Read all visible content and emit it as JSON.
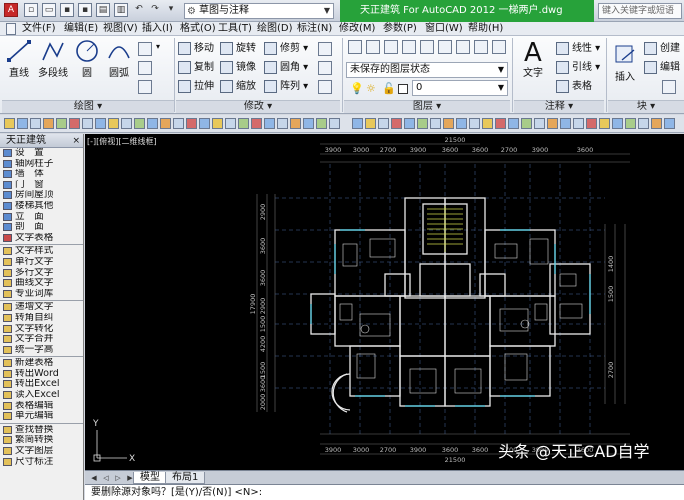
{
  "title_bar": {
    "workspace": "草图与注释",
    "app_title": "天正建筑 For AutoCAD 2012    一梯两户.dwg",
    "search_placeholder": "键入关键字或短语"
  },
  "menu": [
    "文件(F)",
    "编辑(E)",
    "视图(V)",
    "插入(I)",
    "格式(O)",
    "工具(T)",
    "绘图(D)",
    "标注(N)",
    "修改(M)",
    "参数(P)",
    "窗口(W)",
    "帮助(H)"
  ],
  "ribbon": {
    "draw": {
      "label": "绘图",
      "tools": [
        "直线",
        "多段线",
        "圆",
        "圆弧"
      ]
    },
    "modify": {
      "label": "修改",
      "tools": [
        "移动",
        "旋转",
        "修剪",
        "复制",
        "镜像",
        "圆角",
        "拉伸",
        "缩放",
        "阵列"
      ]
    },
    "layers": {
      "label": "图层",
      "state": "未保存的图层状态",
      "current": "0"
    },
    "annotation": {
      "label": "注释",
      "text_label": "文字",
      "tools": [
        "线性",
        "引线",
        "表格"
      ]
    },
    "block": {
      "label": "块",
      "insert_label": "插入",
      "tools": [
        "创建",
        "编辑"
      ]
    }
  },
  "tz_panel": {
    "title": "天正建筑",
    "groups": [
      [
        "设　置",
        "轴网柱子",
        "墙　体",
        "门　窗",
        "房间屋顶",
        "楼梯其他",
        "立　面",
        "剖　面",
        "文字表格"
      ],
      [
        "文字样式",
        "单行文字",
        "多行文字",
        "曲线文字",
        "专业词库"
      ],
      [
        "递增文字",
        "转角自纠",
        "文字转化",
        "文字合并",
        "统一字高"
      ],
      [
        "新建表格",
        "转出Word",
        "转出Excel",
        "读入Excel",
        "表格编辑",
        "单元编辑"
      ],
      [
        "查找替换",
        "繁简转换",
        "文字图层",
        "尺寸标注"
      ]
    ]
  },
  "drawing": {
    "viewport_label": "[-][俯视][二维线框]",
    "dims_top": [
      "3900",
      "3000",
      "2700",
      "3900",
      "3600",
      "3600",
      "2700",
      "3900",
      "3600"
    ],
    "dim_total": "21500",
    "dims_left": [
      "2900",
      "3600",
      "3600",
      "2900",
      "1500",
      "4200",
      "1500",
      "3600",
      "2000"
    ],
    "dim_total_left": "17900",
    "dims_right": [
      "1400",
      "1500",
      "2700"
    ],
    "axis_y": "Y",
    "axis_x": "X"
  },
  "tabs": [
    "模型",
    "布局1"
  ],
  "command_line": "要删除源对象吗？[是(Y)/否(N)] <N>:",
  "watermark": "头条 @天正CAD自学"
}
